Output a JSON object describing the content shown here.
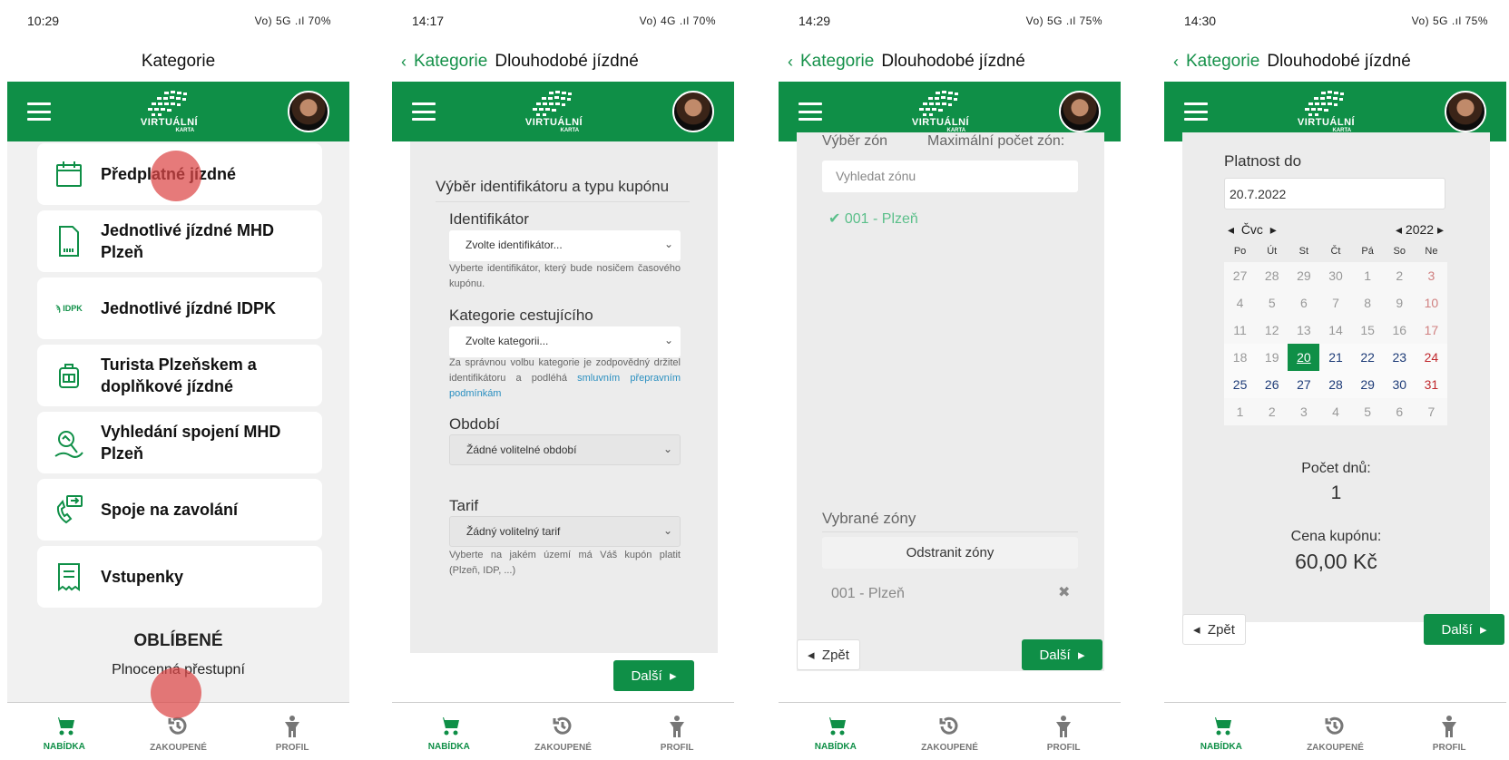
{
  "colors": {
    "brand_green": "#0f8f47",
    "link_green": "#16914a",
    "tap_highlight": "#dc4646",
    "sunday_red": "#c0282d"
  },
  "brand": {
    "logo_line1": "VIRTUÁLNÍ",
    "logo_line2": "KARTA"
  },
  "bottom_nav": {
    "offer": "NABÍDKA",
    "purchased": "ZAKOUPENÉ",
    "profile": "PROFIL"
  },
  "screen1": {
    "status": {
      "time": "10:29",
      "icons": "Vo) 5G .ıl 70%",
      "battery": "70%"
    },
    "title": "Kategorie",
    "menu": [
      {
        "label": "Předplatné jízdné",
        "icon": "calendar-icon"
      },
      {
        "label": "Jednotlivé jízdné MHD Plzeň",
        "icon": "ticket-card-icon"
      },
      {
        "label": "Jednotlivé jízdné IDPK",
        "icon": "idpk-logo-icon"
      },
      {
        "label": "Turista Plzeňskem a doplňkové jízdné",
        "icon": "backpack-icon"
      },
      {
        "label": "Vyhledání spojení MHD Plzeň",
        "icon": "route-search-icon"
      },
      {
        "label": "Spoje na zavolání",
        "icon": "phone-call-icon"
      },
      {
        "label": "Vstupenky",
        "icon": "receipt-icon"
      }
    ],
    "idpk_badge": "IDPK",
    "favorites_heading": "OBLÍBENÉ",
    "favorites_item": "Plnocenná přestupní"
  },
  "screen2": {
    "status": {
      "time": "14:17",
      "icons": "Vo) 4G .ıl 70%"
    },
    "back_label": "Kategorie",
    "title": "Dlouhodobé jízdné",
    "section_title": "Výběr identifikátoru a typu kupónu",
    "identifier": {
      "label": "Identifikátor",
      "value": "Zvolte identifikátor...",
      "help": "Vyberte identifikátor, který bude nosičem časového kupónu."
    },
    "category": {
      "label": "Kategorie cestujícího",
      "value": "Zvolte kategorii...",
      "help": "Za správnou volbu kategorie je zodpovědný držitel identifikátoru a podléhá",
      "help_link": "smluvním přepravním podmínkám"
    },
    "period": {
      "label": "Období",
      "value": "Žádné volitelné období"
    },
    "tariff": {
      "label": "Tarif",
      "value": "Žádný volitelný tarif",
      "help": "Vyberte na jakém území má Váš kupón platit (Plzeň, IDP, ...)"
    },
    "next_label": "Další"
  },
  "screen3": {
    "status": {
      "time": "14:29",
      "icons": "Vo) 5G .ıl 75%"
    },
    "back_label": "Kategorie",
    "title": "Dlouhodobé jízdné",
    "zone_select_label": "Výběr zón",
    "max_zones_label": "Maximální počet zón:",
    "search_placeholder": "Vyhledat zónu",
    "available_zone": "001 - Plzeň",
    "selected_label": "Vybrané zóny",
    "remove_label": "Odstranit zóny",
    "selected_zone": "001 - Plzeň",
    "back_button": "Zpět",
    "next_label": "Další"
  },
  "screen4": {
    "status": {
      "time": "14:30",
      "icons": "Vo) 5G .ıl 75%"
    },
    "back_label": "Kategorie",
    "title": "Dlouhodobé jízdné",
    "valid_until_label": "Platnost do",
    "date_value": "20.7.2022",
    "calendar": {
      "month": "Čvc",
      "year": "2022",
      "weekdays": [
        "Po",
        "Út",
        "St",
        "Čt",
        "Pá",
        "So",
        "Ne"
      ],
      "weeks": [
        [
          "27",
          "28",
          "29",
          "30",
          "1",
          "2",
          "3"
        ],
        [
          "4",
          "5",
          "6",
          "7",
          "8",
          "9",
          "10"
        ],
        [
          "11",
          "12",
          "13",
          "14",
          "15",
          "16",
          "17"
        ],
        [
          "18",
          "19",
          "20",
          "21",
          "22",
          "23",
          "24"
        ],
        [
          "25",
          "26",
          "27",
          "28",
          "29",
          "30",
          "31"
        ],
        [
          "1",
          "2",
          "3",
          "4",
          "5",
          "6",
          "7"
        ]
      ],
      "selected_day": "20"
    },
    "days_label": "Počet dnů:",
    "days_value": "1",
    "price_label": "Cena kupónu:",
    "price_value": "60,00 Kč",
    "back_button": "Zpět",
    "next_label": "Další"
  }
}
